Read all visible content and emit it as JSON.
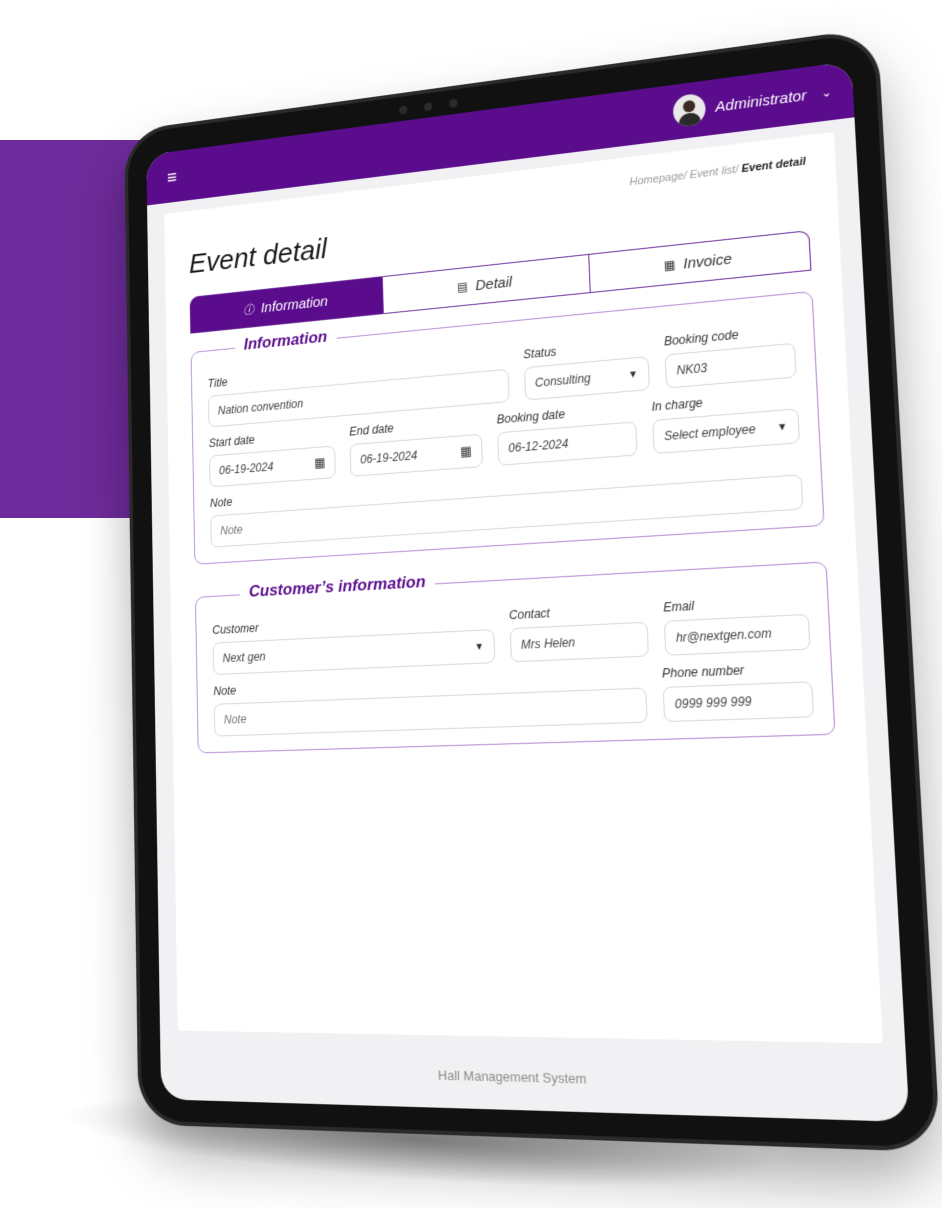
{
  "header": {
    "username": "Administrator"
  },
  "breadcrumb": {
    "home": "Homepage/",
    "list": "Event list/",
    "current": "Event detail"
  },
  "page": {
    "title": "Event detail"
  },
  "tabs": [
    {
      "label": "Information",
      "active": true
    },
    {
      "label": "Detail",
      "active": false
    },
    {
      "label": "Invoice",
      "active": false
    }
  ],
  "information": {
    "section_title": "Information",
    "title_label": "Title",
    "title_value": "Nation convention",
    "status_label": "Status",
    "status_value": "Consulting",
    "booking_code_label": "Booking code",
    "booking_code_value": "NK03",
    "start_date_label": "Start date",
    "start_date_value": "06-19-2024",
    "end_date_label": "End date",
    "end_date_value": "06-19-2024",
    "booking_date_label": "Booking date",
    "booking_date_value": "06-12-2024",
    "in_charge_label": "In charge",
    "in_charge_value": "Select employee",
    "note_label": "Note",
    "note_placeholder": "Note"
  },
  "customer": {
    "section_title": "Customer’s information",
    "customer_label": "Customer",
    "customer_value": "Next gen",
    "contact_label": "Contact",
    "contact_value": "Mrs Helen",
    "email_label": "Email",
    "email_value": "hr@nextgen.com",
    "note_label": "Note",
    "note_placeholder": "Note",
    "phone_label": "Phone number",
    "phone_value": "0999 999 999"
  },
  "footer": {
    "text": "Hall Management System"
  },
  "colors": {
    "primary": "#5a0c8d",
    "band": "#6d2a9a"
  }
}
